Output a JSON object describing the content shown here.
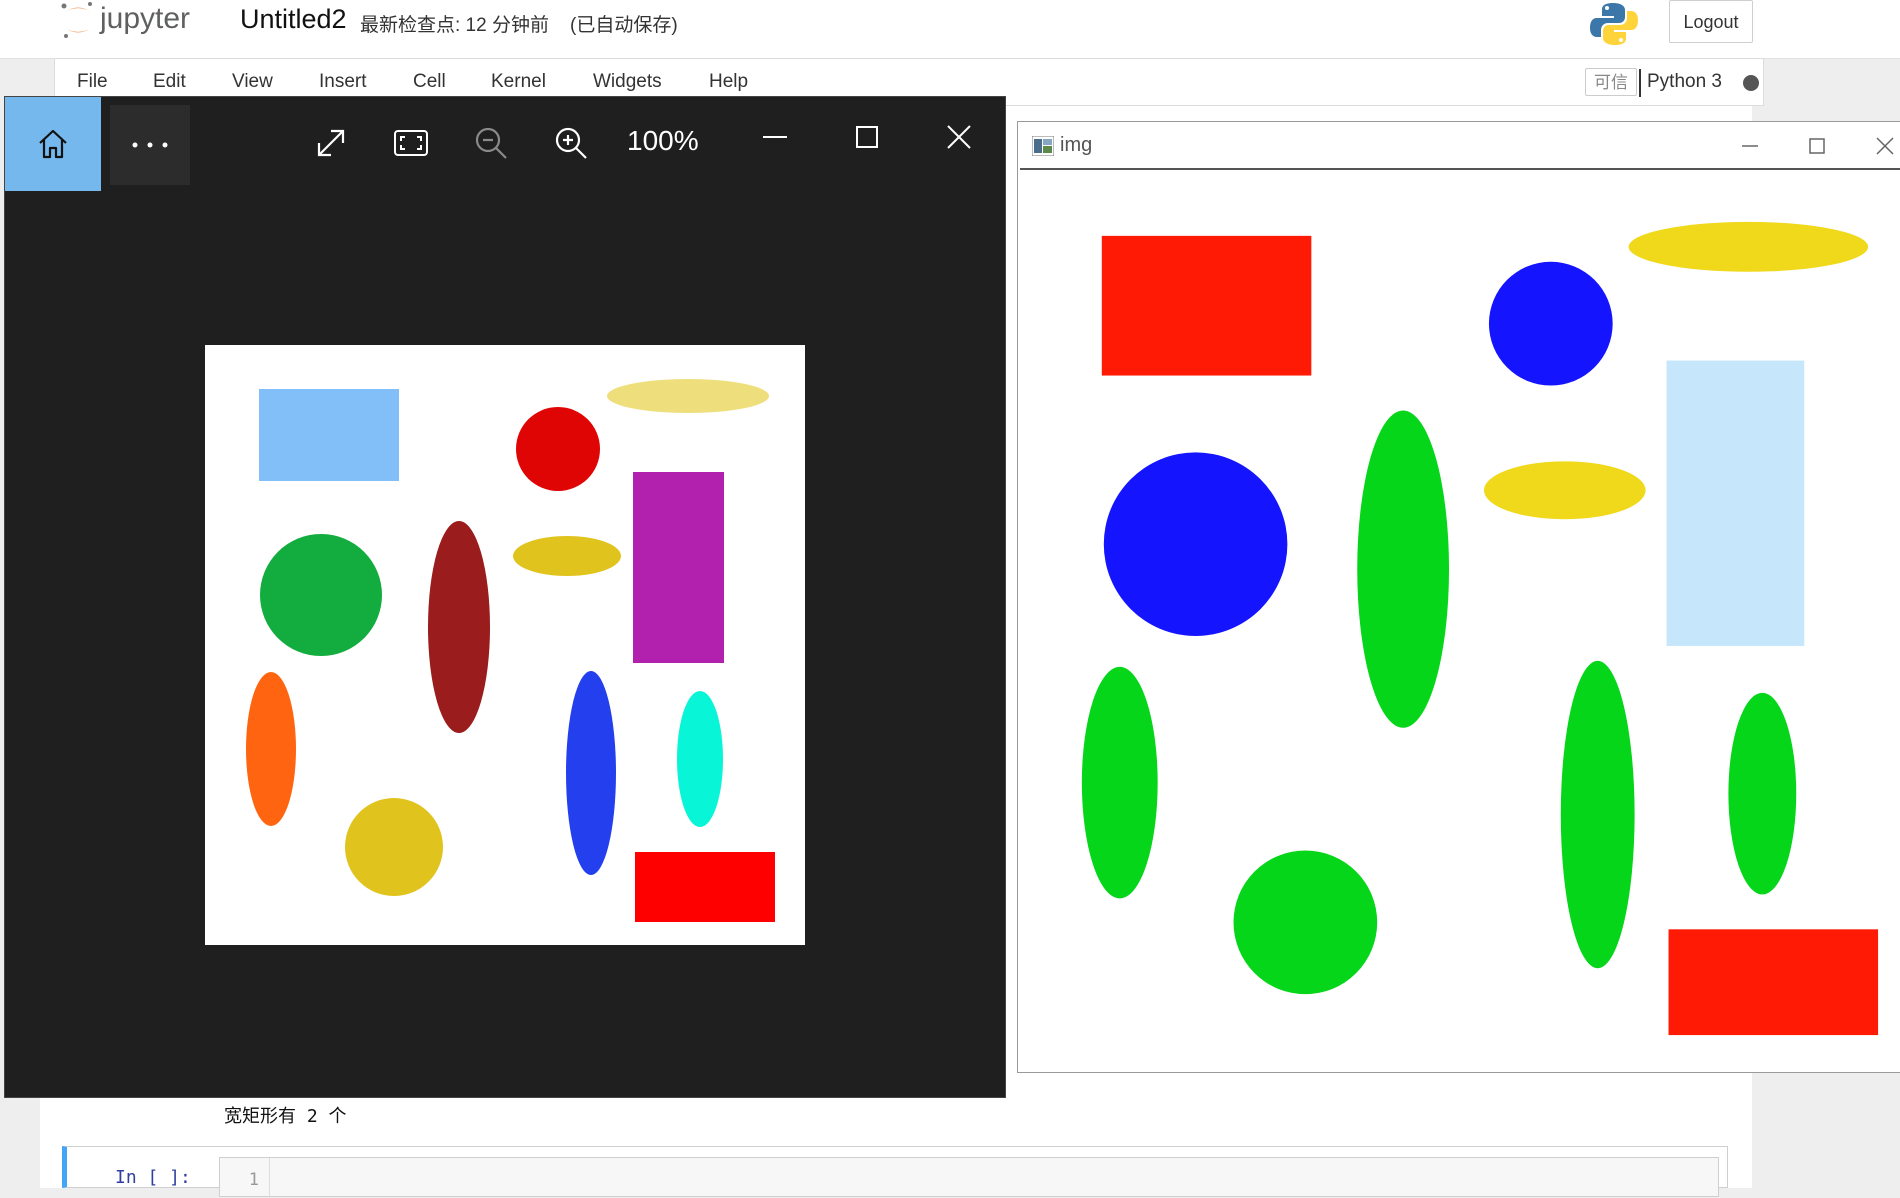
{
  "header": {
    "logo_text": "jupyter",
    "notebook_title": "Untitled2",
    "checkpoint_text": "最新检查点: 12 分钟前",
    "autosave_text": "(已自动保存)",
    "logout_label": "Logout"
  },
  "menubar": {
    "items": [
      "File",
      "Edit",
      "View",
      "Insert",
      "Cell",
      "Kernel",
      "Widgets",
      "Help"
    ],
    "trusted_label": "可信",
    "kernel_name": "Python 3"
  },
  "notebook": {
    "output_line": "宽矩形有 2 个",
    "input_prompt": "In [ ]:",
    "line_number": "1"
  },
  "photo_viewer": {
    "zoom_level": "100%",
    "icons": [
      "home-icon",
      "more-icon",
      "expand-icon",
      "fit-screen-icon",
      "zoom-out-icon",
      "zoom-in-icon",
      "minimize-icon",
      "maximize-icon",
      "close-icon"
    ],
    "colors": {
      "background": "#1f1f1f",
      "home_highlight": "#75b8ed",
      "light_blue_rect": "#82bef7",
      "pale_yellow_ellipse": "#efdf7c",
      "red_circle": "#e00505",
      "purple_rect": "#b221ae",
      "green_circle": "#12ad3e",
      "dark_red_ellipse": "#9a1c1c",
      "yellow_ellipse": "#e1c31d",
      "orange_ellipse": "#ff6510",
      "yellow_circle": "#e1c31d",
      "blue_ellipse": "#2440ee",
      "cyan_ellipse": "#08f5d8",
      "red_rect": "#ff0000"
    }
  },
  "img_window": {
    "title": "img",
    "colors": {
      "red": "#ff1a05",
      "blue": "#1414ff",
      "yellow": "#f0d81a",
      "light_blue": "#c6e7fb",
      "green": "#05d61a"
    }
  }
}
